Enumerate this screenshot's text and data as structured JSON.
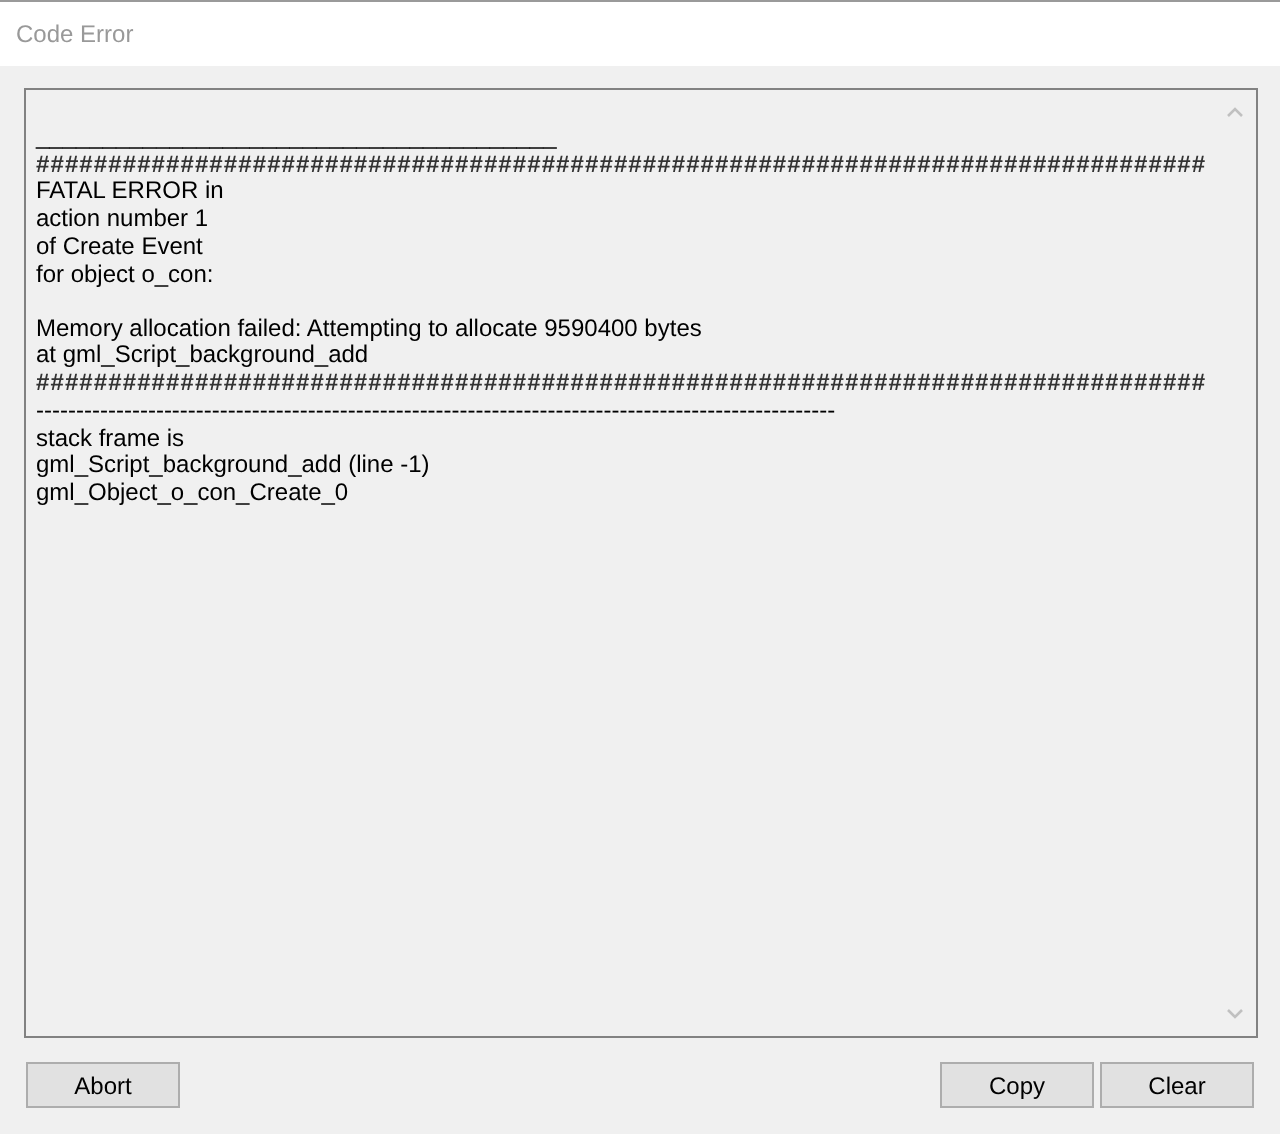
{
  "window": {
    "title": "Code Error"
  },
  "log": {
    "paragraphs": [
      [
        "_______________________________________",
        "#################################################################################",
        "FATAL ERROR in",
        "action number 1",
        "of Create Event",
        "for object o_con:"
      ],
      [
        "Memory allocation failed: Attempting to allocate 9590400 bytes",
        "at gml_Script_background_add",
        "#################################################################################",
        "----------------------------------------------------------------------------------------------------",
        "stack frame is",
        "gml_Script_background_add (line -1)",
        "gml_Object_o_con_Create_0"
      ]
    ]
  },
  "left_buttons": [
    "Abort"
  ],
  "right_buttons": [
    "Copy",
    "Clear"
  ]
}
